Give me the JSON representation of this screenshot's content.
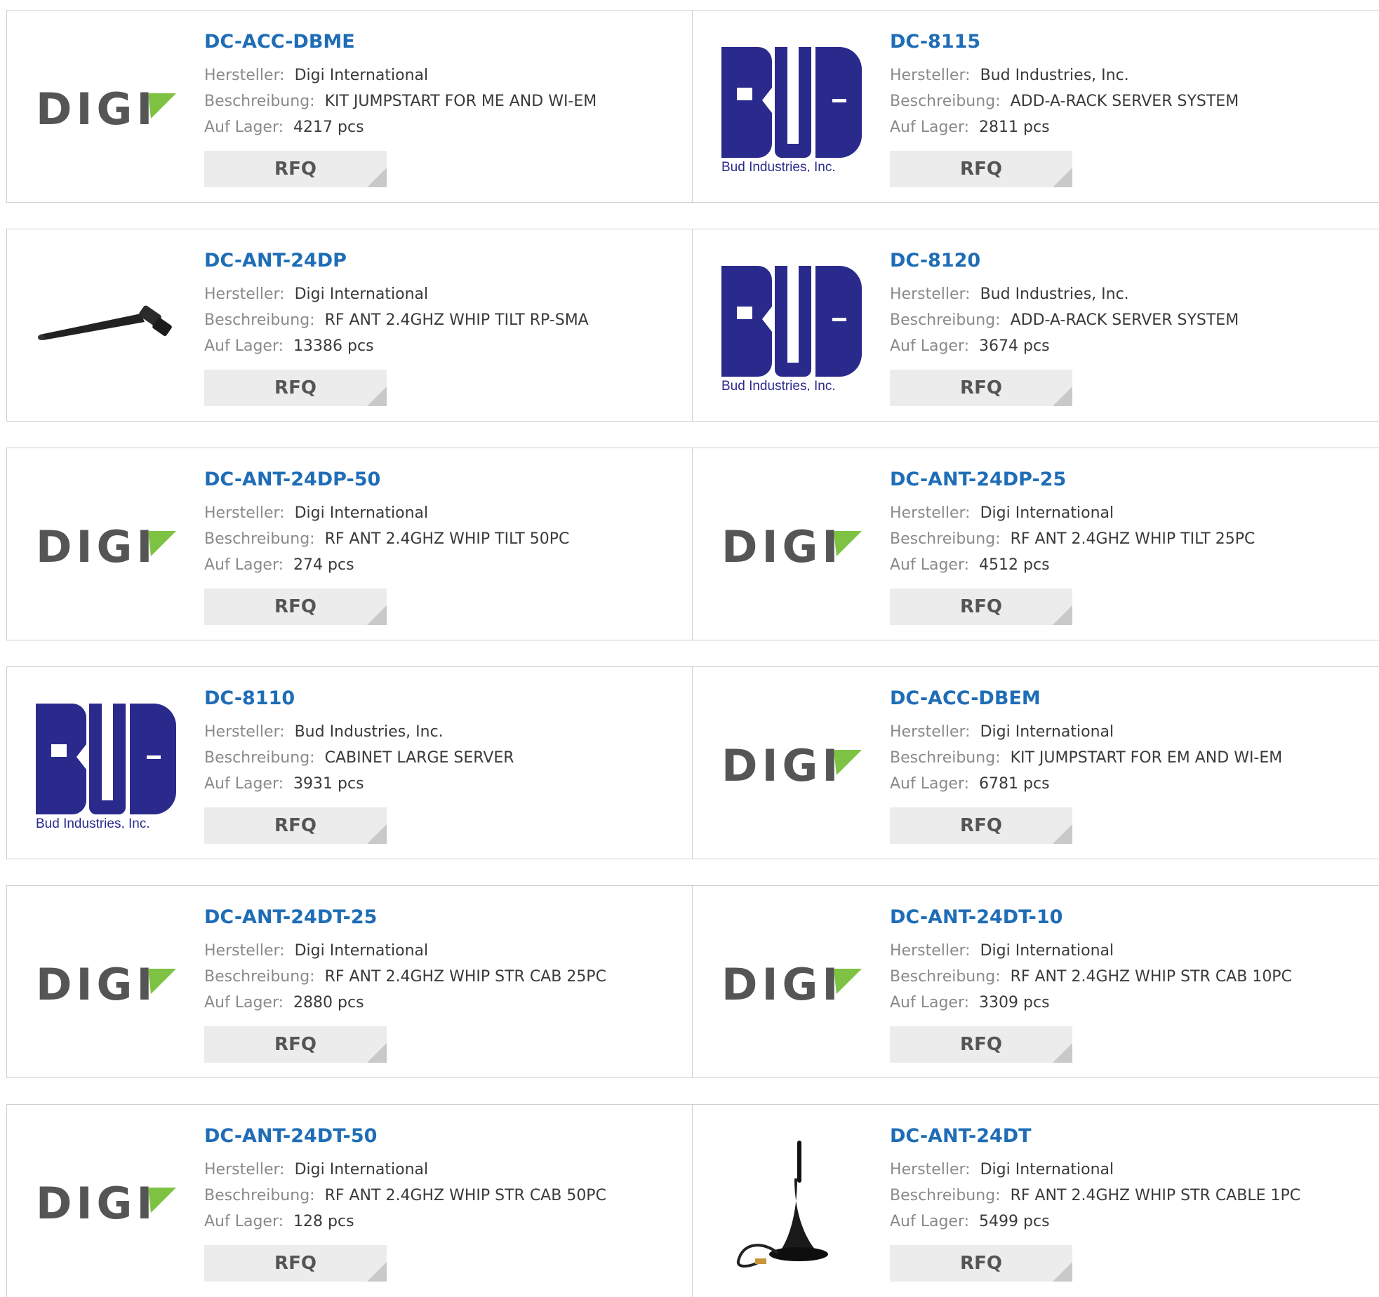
{
  "labels": {
    "manufacturer": "Hersteller:",
    "description": "Beschreibung:",
    "stock": "Auf Lager:",
    "rfq": "RFQ"
  },
  "logo_texts": {
    "digi": "DIGI",
    "bud": "Bud Industries, Inc."
  },
  "colors": {
    "part_link": "#1f6db6",
    "digi_gray": "#555555",
    "digi_green": "#7dc242",
    "bud_navy": "#2a2a8c"
  },
  "products": [
    {
      "part": "DC-ACC-DBME",
      "manufacturer": "Digi International",
      "description": "KIT JUMPSTART FOR ME AND WI-EM",
      "stock": "4217 pcs",
      "logo": "digi"
    },
    {
      "part": "DC-8115",
      "manufacturer": "Bud Industries, Inc.",
      "description": "ADD-A-RACK SERVER SYSTEM",
      "stock": "2811 pcs",
      "logo": "bud"
    },
    {
      "part": "DC-ANT-24DP",
      "manufacturer": "Digi International",
      "description": "RF ANT 2.4GHZ WHIP TILT RP-SMA",
      "stock": "13386 pcs",
      "logo": "antenna-whip"
    },
    {
      "part": "DC-8120",
      "manufacturer": "Bud Industries, Inc.",
      "description": "ADD-A-RACK SERVER SYSTEM",
      "stock": "3674 pcs",
      "logo": "bud"
    },
    {
      "part": "DC-ANT-24DP-50",
      "manufacturer": "Digi International",
      "description": "RF ANT 2.4GHZ WHIP TILT 50PC",
      "stock": "274 pcs",
      "logo": "digi"
    },
    {
      "part": "DC-ANT-24DP-25",
      "manufacturer": "Digi International",
      "description": "RF ANT 2.4GHZ WHIP TILT 25PC",
      "stock": "4512 pcs",
      "logo": "digi"
    },
    {
      "part": "DC-8110",
      "manufacturer": "Bud Industries, Inc.",
      "description": "CABINET LARGE SERVER",
      "stock": "3931 pcs",
      "logo": "bud"
    },
    {
      "part": "DC-ACC-DBEM",
      "manufacturer": "Digi International",
      "description": "KIT JUMPSTART FOR EM AND WI-EM",
      "stock": "6781 pcs",
      "logo": "digi"
    },
    {
      "part": "DC-ANT-24DT-25",
      "manufacturer": "Digi International",
      "description": "RF ANT 2.4GHZ WHIP STR CAB 25PC",
      "stock": "2880 pcs",
      "logo": "digi"
    },
    {
      "part": "DC-ANT-24DT-10",
      "manufacturer": "Digi International",
      "description": "RF ANT 2.4GHZ WHIP STR CAB 10PC",
      "stock": "3309 pcs",
      "logo": "digi"
    },
    {
      "part": "DC-ANT-24DT-50",
      "manufacturer": "Digi International",
      "description": "RF ANT 2.4GHZ WHIP STR CAB 50PC",
      "stock": "128 pcs",
      "logo": "digi"
    },
    {
      "part": "DC-ANT-24DT",
      "manufacturer": "Digi International",
      "description": "RF ANT 2.4GHZ WHIP STR CABLE 1PC",
      "stock": "5499 pcs",
      "logo": "antenna-magnetic"
    }
  ]
}
